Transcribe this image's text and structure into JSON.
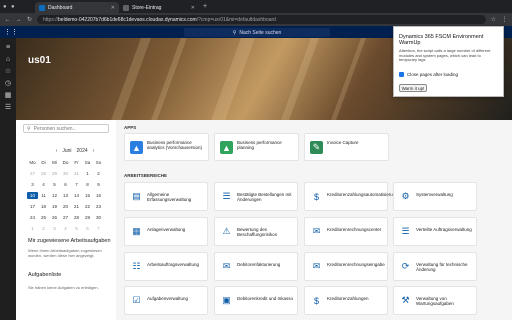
{
  "browser": {
    "tabs": [
      {
        "label": "Dashboard",
        "color": "#0f6cbd"
      },
      {
        "label": "Store-Eintrag",
        "color": "#5f6368"
      }
    ],
    "url_prefix": "https://",
    "url_host": "beldemo-042207b7d6b1de68c1devaos.cloudax.dynamics.com",
    "url_path": "/?cmp=usr01&mi=defaultdashboard"
  },
  "topbar": {
    "search_label": "Nach Seite suchen"
  },
  "hero": {
    "company": "us01"
  },
  "left": {
    "people_search_placeholder": "Personen suchen...",
    "calendar": {
      "month": "Juni",
      "year": "2024",
      "weekdays": [
        "Mo",
        "Di",
        "Mi",
        "Do",
        "Fr",
        "Sa",
        "So"
      ],
      "rows": [
        [
          "27",
          "28",
          "29",
          "30",
          "31",
          "1",
          "2"
        ],
        [
          "3",
          "4",
          "5",
          "6",
          "7",
          "8",
          "9"
        ],
        [
          "10",
          "11",
          "12",
          "13",
          "14",
          "15",
          "16"
        ],
        [
          "17",
          "18",
          "19",
          "20",
          "21",
          "22",
          "23"
        ],
        [
          "24",
          "25",
          "26",
          "27",
          "28",
          "29",
          "30"
        ],
        [
          "1",
          "2",
          "3",
          "4",
          "5",
          "6",
          "7"
        ]
      ],
      "selected": "10"
    },
    "work_title": "Mir zugewiesene Arbeitsaufgaben",
    "work_note": "Wenn Ihnen Arbeitsaufgaben zugewiesen wurden, werden diese hier angezeigt.",
    "task_title": "Aufgabenliste",
    "task_note": "Sie haben keine Aufgaben zu erledigen."
  },
  "sections": {
    "apps": "APPS",
    "workspaces": "ARBEITSBEREICHE"
  },
  "apps": [
    {
      "label": "Business performance analytics (Vorschauversion)",
      "icon": "chart-icon",
      "color": "#2a7de1"
    },
    {
      "label": "Business performance planning",
      "icon": "chart-icon",
      "color": "#30a35d"
    },
    {
      "label": "Invoice Capture",
      "icon": "invoice-icon",
      "color": "#2e8b57"
    }
  ],
  "workspaces": [
    {
      "label": "Allgemeine Erfassungsverwaltung",
      "icon": "ledger-icon"
    },
    {
      "label": "Bestätigte Bestellungen mit Änderungen",
      "icon": "order-icon"
    },
    {
      "label": "Kreditorenzahlungsautomatisierung",
      "icon": "payment-icon"
    },
    {
      "label": "Systemverwaltung",
      "icon": "settings-icon"
    },
    {
      "label": "Anlagenverwaltung",
      "icon": "asset-icon"
    },
    {
      "label": "Bewertung des Beschaffungsrisikos",
      "icon": "risk-icon"
    },
    {
      "label": "Kreditorenrechnungscenter",
      "icon": "invoice-icon"
    },
    {
      "label": "Verteilte Auftragsverwaltung",
      "icon": "order-icon"
    },
    {
      "label": "Arbeitsauftragsverwaltung",
      "icon": "worker-icon"
    },
    {
      "label": "Debitorenfakturierung",
      "icon": "invoice-icon"
    },
    {
      "label": "Kreditorenrechnungseingabe",
      "icon": "invoice-icon"
    },
    {
      "label": "Verwaltung für technische Änderung",
      "icon": "change-icon"
    },
    {
      "label": "Aufgabenverwaltung",
      "icon": "task-icon"
    },
    {
      "label": "Debitorenkredit und Inkasso",
      "icon": "credit-icon"
    },
    {
      "label": "Kreditorenzahlungen",
      "icon": "payment-icon"
    },
    {
      "label": "Verwaltung von Wartungsaufgaben",
      "icon": "maintenance-icon"
    }
  ],
  "popup": {
    "title": "Dynamics 365 FSCM Environment WarmUp",
    "description": "Attention, the script calls a large number of different modules and system pages, which can lead to temporary lags",
    "checkbox_label": "Close pages after loading",
    "button_label": "Warm it up!"
  }
}
